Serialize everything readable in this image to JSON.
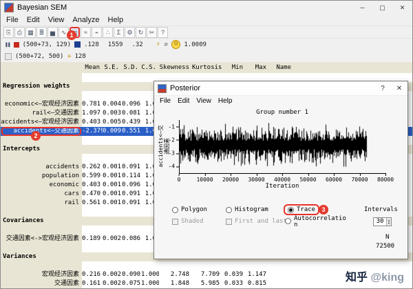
{
  "window": {
    "title": "Bayesian SEM",
    "menu": [
      "File",
      "Edit",
      "View",
      "Analyze",
      "Help"
    ],
    "controls": {
      "minimize": "─",
      "maximize": "▢",
      "close": "✕"
    }
  },
  "toolbar": {
    "icons": [
      {
        "name": "copy-icon",
        "glyph": "⎘"
      },
      {
        "name": "print-icon",
        "glyph": "⎙"
      },
      {
        "name": "table-icon",
        "glyph": "▦"
      },
      {
        "name": "list-icon",
        "glyph": "≣"
      },
      {
        "name": "histogram-icon",
        "glyph": "▅"
      },
      {
        "name": "polygon-icon",
        "glyph": "∿"
      },
      {
        "name": "posterior-plot-icon",
        "glyph": "◫",
        "highlighted": true
      },
      {
        "name": "trace-plot-icon",
        "glyph": "≈"
      },
      {
        "name": "autocorrelation-icon",
        "glyph": "⌁"
      },
      {
        "name": "scatter-icon",
        "glyph": "∴"
      },
      {
        "name": "summary-icon",
        "glyph": "Σ"
      },
      {
        "name": "options-icon",
        "glyph": "⚙"
      },
      {
        "name": "refresh-icon",
        "glyph": "↻"
      },
      {
        "name": "cut-icon",
        "glyph": "✂"
      },
      {
        "name": "help-icon",
        "glyph": "?"
      }
    ],
    "row2": {
      "pause_glyph": "❚❚",
      "sample_text": "(500+73, 129)",
      "value1": ".128",
      "value2": "1559",
      "value3": ".32",
      "lightning_glyph": "⚡",
      "magnifier_glyph": "⌕",
      "smiley_glyph": "☺",
      "convergence": "1.0009"
    },
    "row3": {
      "text": "(500+72, 500)",
      "asterisk_glyph": "✳",
      "value": "128"
    }
  },
  "annotations": {
    "step1": "1",
    "step2": "2",
    "step3": "3"
  },
  "colors": {
    "annotation_red": "#e8332a",
    "selection_blue": "#2b5fc7",
    "table_beige": "#e9e5d4"
  },
  "table": {
    "columns": [
      "Mean",
      "S.E.",
      "S.D.",
      "C.S.",
      "Skewness",
      "Kurtosis",
      "Min",
      "Max",
      "Name"
    ],
    "rows": [
      {
        "type": "blank"
      },
      {
        "type": "section",
        "label": "Regression weights"
      },
      {
        "type": "blank"
      },
      {
        "type": "data",
        "label": "economic<—宏观经济因素",
        "values": [
          "0.781",
          "0.004",
          "0.096",
          "1.0"
        ]
      },
      {
        "type": "data",
        "label": "rail<—交通因素",
        "values": [
          "1.097",
          "0.003",
          "0.081",
          "1.0"
        ]
      },
      {
        "type": "data",
        "label": "accidents<—宏观经济因素",
        "values": [
          "0.403",
          "0.005",
          "0.439",
          "1.0"
        ]
      },
      {
        "type": "data",
        "label": "accidents<—交通因素",
        "values": [
          "-2.379",
          "0.009",
          "0.551",
          "1.0"
        ],
        "selected": true,
        "annotated": true
      },
      {
        "type": "blank"
      },
      {
        "type": "section",
        "label": "Intercepts"
      },
      {
        "type": "blank"
      },
      {
        "type": "data",
        "label": "accidents",
        "values": [
          "0.262",
          "0.001",
          "0.091",
          "1.0"
        ]
      },
      {
        "type": "data",
        "label": "population",
        "values": [
          "0.599",
          "0.001",
          "0.114",
          "1.0"
        ]
      },
      {
        "type": "data",
        "label": "economic",
        "values": [
          "0.403",
          "0.001",
          "0.096",
          "1.0"
        ]
      },
      {
        "type": "data",
        "label": "cars",
        "values": [
          "0.470",
          "0.001",
          "0.091",
          "1.0"
        ]
      },
      {
        "type": "data",
        "label": "rail",
        "values": [
          "0.561",
          "0.001",
          "0.091",
          "1.0"
        ]
      },
      {
        "type": "blank"
      },
      {
        "type": "section",
        "label": "Covariances"
      },
      {
        "type": "blank"
      },
      {
        "type": "data",
        "label": "交通因素<->宏观经济因素",
        "values": [
          "0.189",
          "0.002",
          "0.086",
          "1.0"
        ]
      },
      {
        "type": "blank"
      },
      {
        "type": "section",
        "label": "Variances"
      },
      {
        "type": "blank"
      },
      {
        "type": "data",
        "label": "宏观经济因素",
        "values": [
          "0.216",
          "0.002",
          "0.090",
          "1.000",
          "2.748",
          "7.709",
          "0.039",
          "1.147"
        ]
      },
      {
        "type": "data",
        "label": "交通因素",
        "values": [
          "0.161",
          "0.002",
          "0.075",
          "1.000",
          "1.848",
          "5.985",
          "0.033",
          "0.815"
        ]
      }
    ]
  },
  "dialog": {
    "title": "Posterior",
    "title_buttons": {
      "help": "?",
      "close": "✕"
    },
    "menu": [
      "File",
      "Edit",
      "View",
      "Help"
    ],
    "plot": {
      "group_label": "Group number 1",
      "y_axis_label": "accidents<—交通因素",
      "x_axis_label": "Iteration",
      "y_ticks": [
        -1,
        -2,
        -3,
        -4
      ],
      "y_top": -0.5,
      "y_bottom": -4.5,
      "x_ticks": [
        0,
        10000,
        20000,
        30000,
        40000,
        50000,
        60000,
        70000,
        80000
      ],
      "x_axis_max": 80000,
      "x_data_max": 72500,
      "mean": -2.379,
      "sd": 0.551
    },
    "controls": {
      "polygon": "Polygon",
      "histogram": "Histogram",
      "trace": "Trace",
      "autocorrelation": "Autocorrelation",
      "shaded": "Shaded",
      "first_and_last": "First and last",
      "intervals_label": "Intervals",
      "intervals_value": "30",
      "n_label": "N",
      "n_value": "72500"
    }
  },
  "watermark": {
    "brand": "知乎",
    "user": "@king"
  }
}
